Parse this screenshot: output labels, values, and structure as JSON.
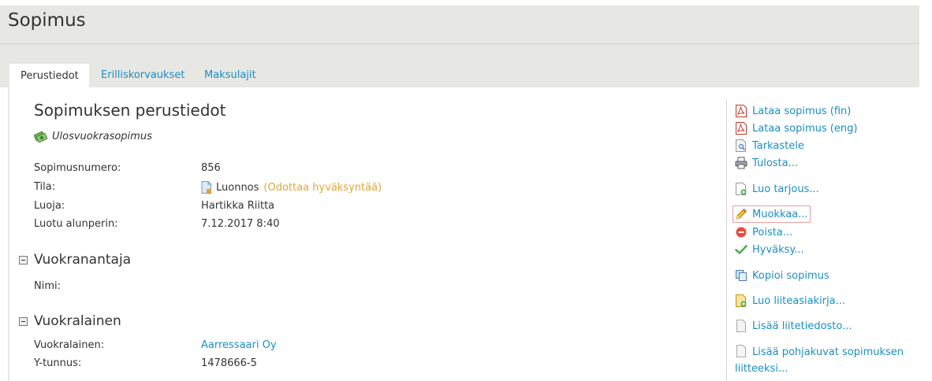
{
  "page": {
    "title": "Sopimus"
  },
  "tabs": [
    {
      "label": "Perustiedot",
      "active": true
    },
    {
      "label": "Erilliskorvaukset",
      "active": false
    },
    {
      "label": "Maksulajit",
      "active": false
    }
  ],
  "main": {
    "section_title": "Sopimuksen perustiedot",
    "contract_type": "Ulosvuokrasopimus",
    "fields": {
      "number_label": "Sopimusnumero:",
      "number_value": "856",
      "status_label": "Tila:",
      "status_value": "Luonnos",
      "status_note": "(Odottaa hyväksyntää)",
      "creator_label": "Luoja:",
      "creator_value": "Hartikka Riitta",
      "created_label": "Luotu alunperin:",
      "created_value": "7.12.2017 8:40"
    },
    "lessor": {
      "title": "Vuokranantaja",
      "name_label": "Nimi:",
      "name_value": ""
    },
    "lessee": {
      "title": "Vuokralainen",
      "lessee_label": "Vuokralainen:",
      "lessee_value": "Aarressaari Oy",
      "business_id_label": "Y-tunnus:",
      "business_id_value": "1478666-5"
    }
  },
  "actions": {
    "download_fin": "Lataa sopimus (fin)",
    "download_eng": "Lataa sopimus (eng)",
    "preview": "Tarkastele",
    "print": "Tulosta...",
    "create_offer": "Luo tarjous...",
    "edit": "Muokkaa...",
    "delete": "Poista...",
    "approve": "Hyväksy...",
    "copy": "Kopioi sopimus",
    "create_attachment_doc": "Luo liiteasiakirja...",
    "add_attachment_file": "Lisää liitetiedosto...",
    "add_floor_plans": "Lisää pohjakuvat sopimuksen liitteeksi..."
  },
  "colors": {
    "link": "#1a8fc4",
    "status_note": "#e8a530",
    "header_bg": "#e7e7e3",
    "highlight_outline": "#e7a0a0"
  },
  "icons": {
    "contract_type": "money-icon",
    "status": "document-draft-icon",
    "pdf": "pdf-icon",
    "preview": "magnifier-document-icon",
    "print": "printer-icon",
    "create": "document-add-icon",
    "edit": "pencil-icon",
    "delete": "minus-circle-icon",
    "approve": "checkmark-icon",
    "copy": "copy-icon",
    "attachment": "blank-document-icon"
  }
}
